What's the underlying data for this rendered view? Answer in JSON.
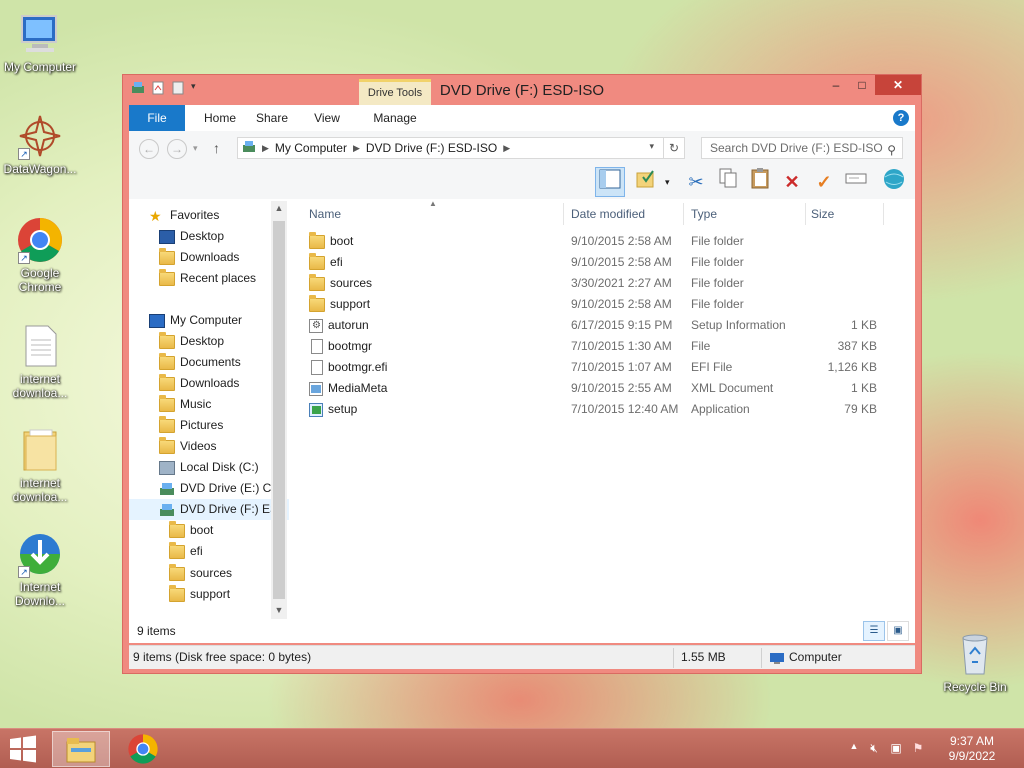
{
  "desktop": {
    "icons": [
      {
        "label": "My Computer",
        "icon": "computer-icon"
      },
      {
        "label": "DataWagon...",
        "icon": "datawagon-icon"
      },
      {
        "label": "Google Chrome",
        "icon": "chrome-icon"
      },
      {
        "label": "internet downloa...",
        "icon": "text-file-icon"
      },
      {
        "label": "internet downloa...",
        "icon": "folder-icon"
      },
      {
        "label": "Internet Downlo...",
        "icon": "idm-icon"
      },
      {
        "label": "Recycle Bin",
        "icon": "recycle-bin-icon"
      }
    ]
  },
  "window": {
    "title": "DVD Drive (F:) ESD-ISO",
    "contextual_tab": "Drive Tools",
    "controls": {
      "minimize": "–",
      "maximize": "□",
      "close": "✕"
    },
    "ribbon_tabs": [
      "File",
      "Home",
      "Share",
      "View",
      "Manage"
    ],
    "help": "?",
    "address": {
      "crumbs": [
        "My Computer",
        "DVD Drive (F:) ESD-ISO"
      ]
    },
    "search": {
      "placeholder": "Search DVD Drive (F:) ESD-ISO"
    },
    "nav": {
      "favorites": {
        "label": "Favorites",
        "items": [
          "Desktop",
          "Downloads",
          "Recent places"
        ]
      },
      "computer": {
        "label": "My Computer",
        "items": [
          "Desktop",
          "Documents",
          "Downloads",
          "Music",
          "Pictures",
          "Videos",
          "Local Disk (C:)",
          "DVD Drive (E:) CC",
          "DVD Drive (F:) ES"
        ]
      },
      "subfolders": [
        "boot",
        "efi",
        "sources",
        "support"
      ]
    },
    "columns": {
      "name": "Name",
      "date": "Date modified",
      "type": "Type",
      "size": "Size"
    },
    "files": [
      {
        "name": "boot",
        "date": "9/10/2015 2:58 AM",
        "type": "File folder",
        "size": "",
        "icon": "folder-icon"
      },
      {
        "name": "efi",
        "date": "9/10/2015 2:58 AM",
        "type": "File folder",
        "size": "",
        "icon": "folder-icon"
      },
      {
        "name": "sources",
        "date": "3/30/2021 2:27 AM",
        "type": "File folder",
        "size": "",
        "icon": "folder-icon"
      },
      {
        "name": "support",
        "date": "9/10/2015 2:58 AM",
        "type": "File folder",
        "size": "",
        "icon": "folder-icon"
      },
      {
        "name": "autorun",
        "date": "6/17/2015 9:15 PM",
        "type": "Setup Information",
        "size": "1 KB",
        "icon": "setup-info-icon"
      },
      {
        "name": "bootmgr",
        "date": "7/10/2015 1:30 AM",
        "type": "File",
        "size": "387 KB",
        "icon": "file-icon"
      },
      {
        "name": "bootmgr.efi",
        "date": "7/10/2015 1:07 AM",
        "type": "EFI File",
        "size": "1,126 KB",
        "icon": "file-icon"
      },
      {
        "name": "MediaMeta",
        "date": "9/10/2015 2:55 AM",
        "type": "XML Document",
        "size": "1 KB",
        "icon": "xml-icon"
      },
      {
        "name": "setup",
        "date": "7/10/2015 12:40 AM",
        "type": "Application",
        "size": "79 KB",
        "icon": "setup-app-icon"
      }
    ],
    "item_count": "9 items",
    "status": {
      "summary": "9 items (Disk free space: 0 bytes)",
      "size": "1.55 MB",
      "location": "Computer"
    }
  },
  "taskbar": {
    "clock_time": "9:37 AM",
    "clock_date": "9/9/2022"
  }
}
